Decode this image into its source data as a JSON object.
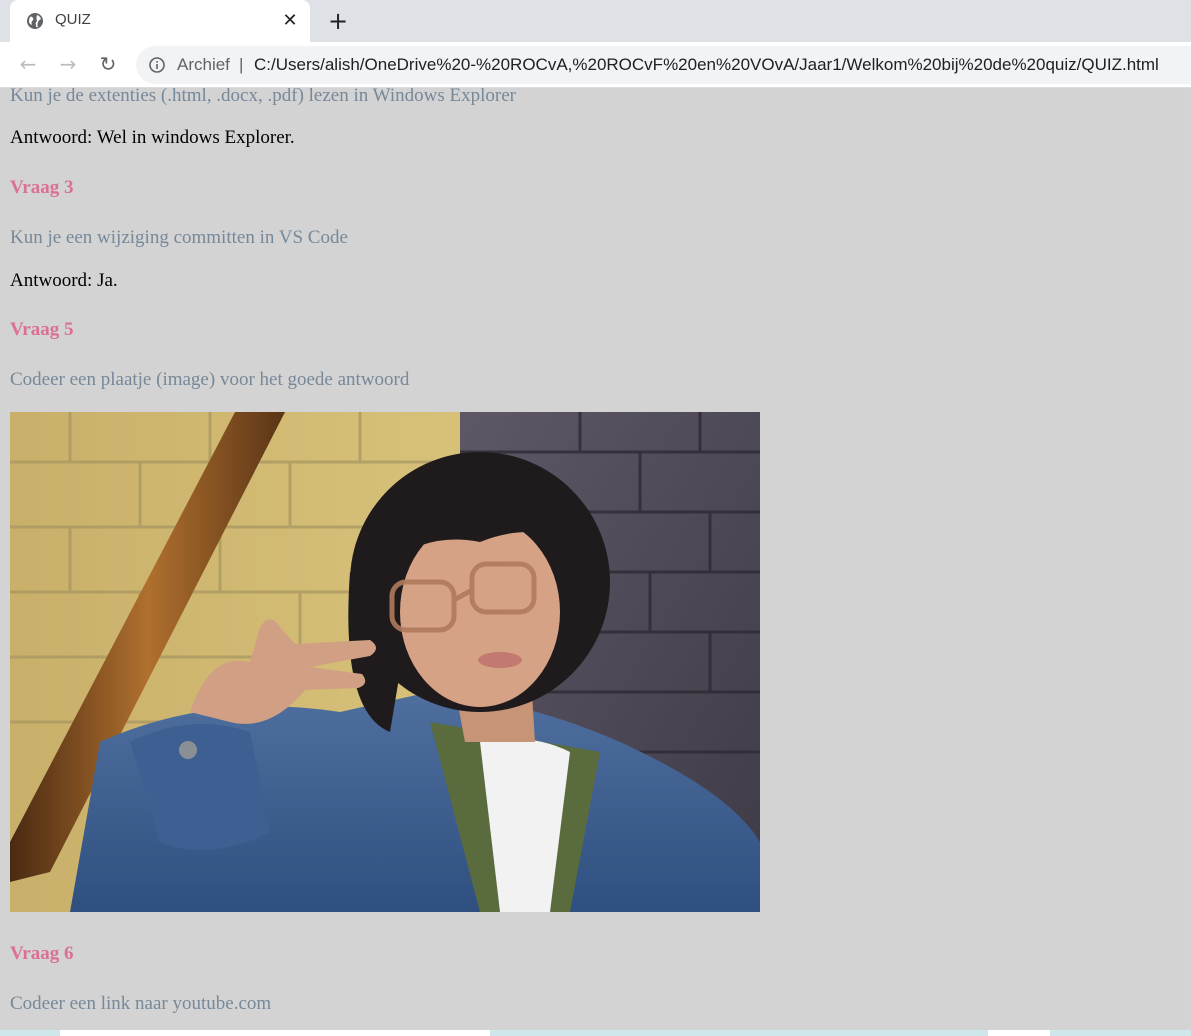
{
  "browser": {
    "tab_title": "QUIZ",
    "close_glyph": "✕",
    "new_tab_glyph": "+",
    "back_glyph": "←",
    "forward_glyph": "→",
    "reload_glyph": "↻",
    "security_label": "Archief",
    "separator": "|",
    "url": "C:/Users/alish/OneDrive%20-%20ROCvA,%20ROCvF%20en%20VOvA/Jaar1/Welkom%20bij%20de%20quiz/QUIZ.html",
    "icons": {
      "tab": "globe-icon",
      "security": "info-icon"
    }
  },
  "page": {
    "q2_text": "Kun je de extenties (.html, .docx, .pdf) lezen in Windows Explorer",
    "q2_answer": "Antwoord: Wel in windows Explorer.",
    "q3_heading": "Vraag 3",
    "q3_text": "Kun je een wijziging committen in VS Code",
    "q3_answer": "Antwoord: Ja.",
    "q5_heading": "Vraag 5",
    "q5_text": "Codeer een plaatje (image) voor het goede antwoord",
    "q6_heading": "Vraag 6",
    "q6_text": "Codeer een link naar youtube.com"
  },
  "colors": {
    "page_background": "#d3d3d3",
    "question_text": "#778899",
    "heading": "#db7093",
    "answer": "#000000"
  }
}
